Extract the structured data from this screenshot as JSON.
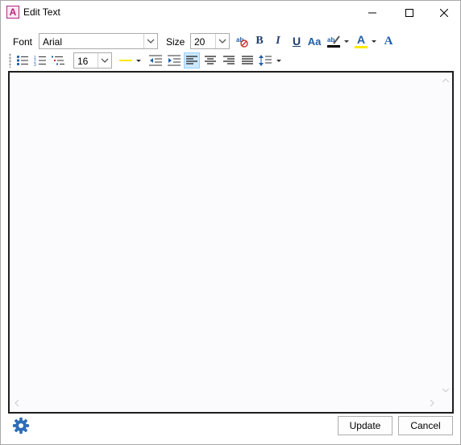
{
  "window": {
    "title": "Edit Text",
    "app_icon_letter": "A"
  },
  "toolbar": {
    "font_label": "Font",
    "font_value": "Arial",
    "size_label": "Size",
    "size_value": "20",
    "bold_label": "B",
    "italic_label": "I",
    "underline_label": "U",
    "case_label": "Aa",
    "font_color_label": "A",
    "font_style_label": "A",
    "line_height_value": "16",
    "highlight_color": "#ffe800",
    "font_color": "#ffe800",
    "accent_color": "#1f5ea8"
  },
  "editor": {
    "content": ""
  },
  "footer": {
    "update_label": "Update",
    "cancel_label": "Cancel"
  }
}
